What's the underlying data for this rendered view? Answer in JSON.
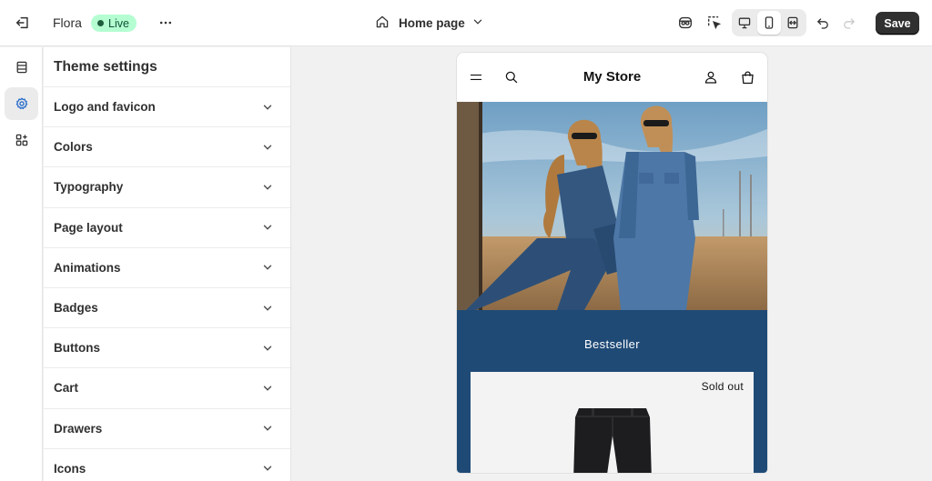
{
  "topbar": {
    "exit_icon": "exit-icon",
    "theme_name": "Flora",
    "status_badge": "Live",
    "status_color": "#b4fed2",
    "more_icon": "ellipsis-icon",
    "page_selector": {
      "icon": "home-icon",
      "label": "Home page"
    },
    "tools": [
      "inspector-icon",
      "select-element-icon"
    ],
    "device_modes": [
      "desktop",
      "mobile",
      "full-width"
    ],
    "active_device": "mobile",
    "save_label": "Save"
  },
  "rail": {
    "items": [
      {
        "name": "sections",
        "icon": "sections-icon"
      },
      {
        "name": "theme-settings",
        "icon": "gear-icon",
        "active": true
      },
      {
        "name": "app-embeds",
        "icon": "apps-icon"
      }
    ],
    "accent": "#2c6ecb"
  },
  "settings": {
    "title": "Theme settings",
    "items": [
      {
        "label": "Logo and favicon"
      },
      {
        "label": "Colors"
      },
      {
        "label": "Typography"
      },
      {
        "label": "Page layout"
      },
      {
        "label": "Animations"
      },
      {
        "label": "Badges"
      },
      {
        "label": "Buttons"
      },
      {
        "label": "Cart"
      },
      {
        "label": "Drawers"
      },
      {
        "label": "Icons"
      }
    ]
  },
  "preview": {
    "store_name": "My Store",
    "collection_heading": "Bestseller",
    "collection_bg": "#1f4a76",
    "product_badge": "Sold out"
  }
}
